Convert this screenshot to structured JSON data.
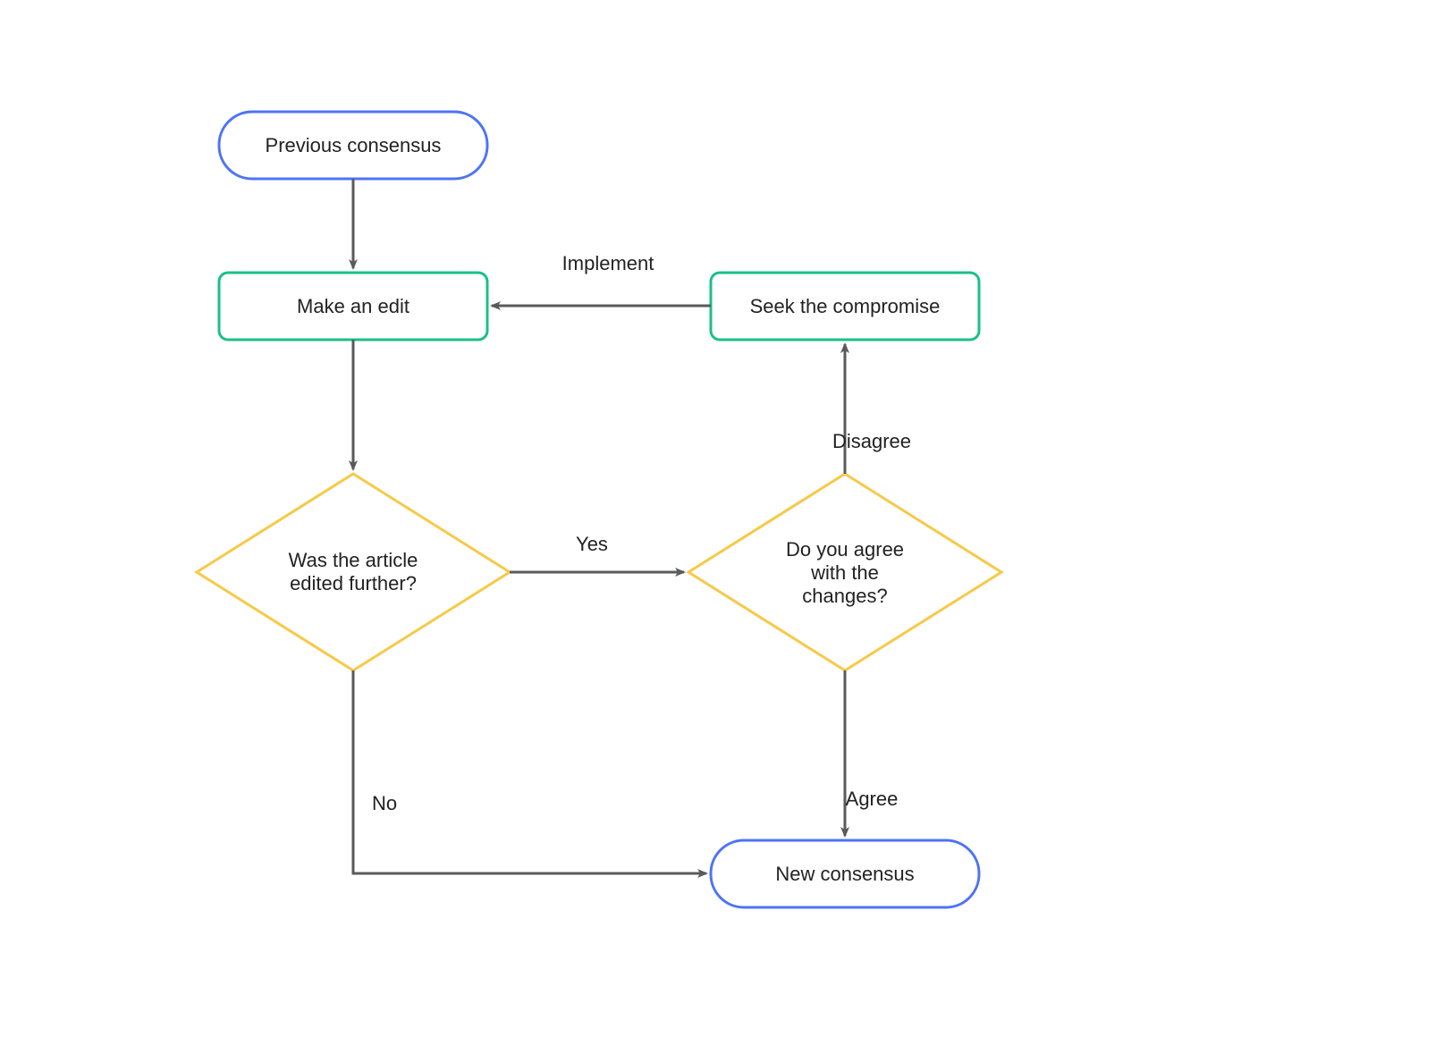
{
  "diagram": {
    "type": "flowchart",
    "nodes": {
      "previous_consensus": {
        "label": "Previous consensus",
        "shape": "terminator",
        "color": "blue"
      },
      "make_edit": {
        "label": "Make an edit",
        "shape": "process",
        "color": "green"
      },
      "seek_compromise": {
        "label": "Seek the compromise",
        "shape": "process",
        "color": "green"
      },
      "edited_further": {
        "label_line1": "Was the article",
        "label_line2": "edited further?",
        "shape": "decision",
        "color": "yellow"
      },
      "agree_changes": {
        "label_line1": "Do you agree",
        "label_line2": "with the",
        "label_line3": "changes?",
        "shape": "decision",
        "color": "yellow"
      },
      "new_consensus": {
        "label": "New consensus",
        "shape": "terminator",
        "color": "blue"
      }
    },
    "edges": {
      "prev_to_edit": {
        "from": "previous_consensus",
        "to": "make_edit",
        "label": ""
      },
      "edit_to_edited": {
        "from": "make_edit",
        "to": "edited_further",
        "label": ""
      },
      "edited_yes": {
        "from": "edited_further",
        "to": "agree_changes",
        "label": "Yes"
      },
      "edited_no": {
        "from": "edited_further",
        "to": "new_consensus",
        "label": "No"
      },
      "agree_disagree": {
        "from": "agree_changes",
        "to": "seek_compromise",
        "label": "Disagree"
      },
      "seek_to_edit": {
        "from": "seek_compromise",
        "to": "make_edit",
        "label": "Implement"
      },
      "agree_agree": {
        "from": "agree_changes",
        "to": "new_consensus",
        "label": "Agree"
      }
    },
    "colors": {
      "blue": "#4e73f8",
      "green": "#1bbf89",
      "yellow": "#f7c948",
      "arrow": "#5a5a5a"
    }
  }
}
